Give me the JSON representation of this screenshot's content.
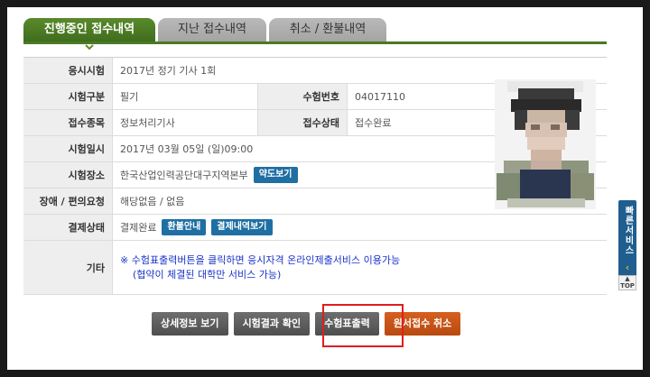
{
  "tabs": [
    {
      "label": "진행중인 접수내역",
      "active": true
    },
    {
      "label": "지난 접수내역",
      "active": false
    },
    {
      "label": "취소 / 환불내역",
      "active": false
    }
  ],
  "info": {
    "exam_label": "응시시험",
    "exam_value": "2017년 정기 기사 1회",
    "type_label": "시험구분",
    "type_value": "필기",
    "number_label": "수험번호",
    "number_value": "04017110",
    "subject_label": "접수종목",
    "subject_value": "정보처리기사",
    "status_label": "접수상태",
    "status_value": "접수완료",
    "date_label": "시험일시",
    "date_value": "2017년 03월 05일 (일)09:00",
    "place_label": "시험장소",
    "place_value": "한국산업인력공단대구지역본부",
    "map_button": "약도보기",
    "access_label": "장애 / 편의요청",
    "access_value": "해당없음 / 없음",
    "payment_label": "결제상태",
    "payment_value": "결제완료",
    "refund_button": "환불안내",
    "payment_detail_button": "결제내역보기",
    "etc_label": "기타",
    "note_line1": "※ 수험표출력버튼을 클릭하면 응시자격 온라인제출서비스 이용가능",
    "note_line2": "(협약이 체결된 대학만 서비스 가능)"
  },
  "actions": {
    "detail": "상세정보 보기",
    "result": "시험결과 확인",
    "print": "수험표출력",
    "cancel": "원서접수 취소"
  },
  "quick": {
    "label": "빠른서비스",
    "top": "TOP"
  },
  "colors": {
    "tab_active": "#4a7a24",
    "small_button": "#1f6fa3",
    "note_text": "#1a33c8",
    "cancel_button": "#c8521a",
    "highlight": "#e01e1e"
  }
}
